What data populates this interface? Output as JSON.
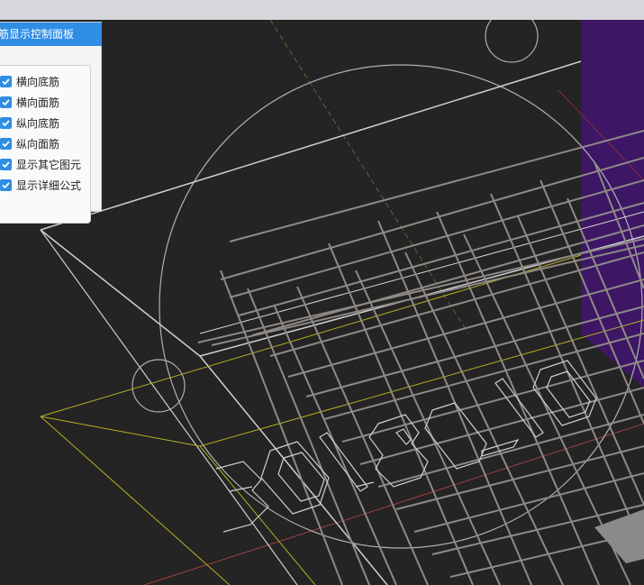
{
  "panel": {
    "title": "筋显示控制面板",
    "options": [
      {
        "label": "横向底筋",
        "checked": true
      },
      {
        "label": "横向面筋",
        "checked": true
      },
      {
        "label": "纵向底筋",
        "checked": true
      },
      {
        "label": "纵向面筋",
        "checked": true
      },
      {
        "label": "显示其它图元",
        "checked": true
      },
      {
        "label": "显示详细公式",
        "checked": true
      }
    ]
  },
  "viewport": {
    "label_text": "3018-10",
    "colors": {
      "background": "#242424",
      "rebar": "#8f8a86",
      "outline": "#c8c8c8",
      "yellow_edge": "#b8b020",
      "purple_region": "#3d1766",
      "accent_blue": "#2f8de4"
    }
  }
}
